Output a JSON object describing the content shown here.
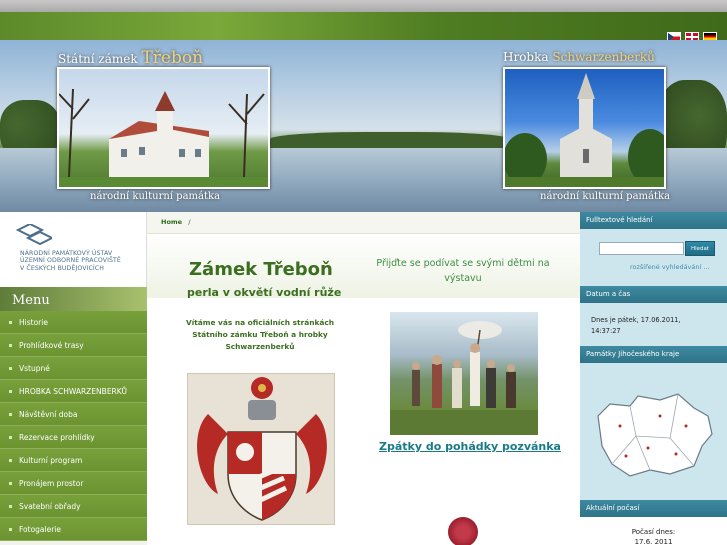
{
  "header": {
    "languages": [
      "cz-flag",
      "en-flag",
      "de-flag"
    ]
  },
  "banner": {
    "left_title_prefix": "Státní zámek",
    "left_title_name": "Třeboň",
    "right_title_prefix": "Hrobka",
    "right_title_name": "Schwarzenberků",
    "left_subtitle": "národní kulturní památka",
    "right_subtitle": "národní kulturní památka"
  },
  "institution": {
    "lines": [
      "NÁRODNÍ PAMÁTKOVÝ ÚSTAV",
      "ÚZEMNÍ ODBORNÉ PRACOVIŠTĚ",
      "V ČESKÝCH BUDĚJOVICÍCH"
    ]
  },
  "menu": {
    "title": "Menu",
    "items": [
      "Historie",
      "Prohlídkové trasy",
      "Vstupné",
      "HROBKA SCHWARZENBERKŮ",
      "Návštěvní doba",
      "Rezervace prohlídky",
      "Kulturní program",
      "Pronájem prostor",
      "Svatební obřady",
      "Fotogalerie"
    ]
  },
  "breadcrumb": {
    "home": "Home",
    "separator": "/"
  },
  "main": {
    "title": "Zámek Třeboň",
    "subtitle": "perla v okvětí vodní růže",
    "welcome": "Vítáme vás na oficiálních stránkách Státního zámku Třeboň a hrobky Schwarzenberků",
    "promo": "Přijďte se podívat se svými dětmi na výstavu",
    "promo_link": "Zpátky do pohádky pozvánka"
  },
  "sidebar": {
    "search_title": "Fulltextové hledání",
    "search_button": "Hledat",
    "search_value": "",
    "advanced_link": "rozšířené vyhledávání ...",
    "datetime_title": "Datum a čas",
    "datetime_line1": "Dnes je pátek, 17.06.2011,",
    "datetime_line2": "14:37:27",
    "region_title": "Památky Jihočeského kraje",
    "weather_title": "Aktuální počasí",
    "weather_line1": "Počasí dnes:",
    "weather_line2": "17.6. 2011"
  },
  "colors": {
    "menu_green": "#6b9431",
    "heading_green": "#3b6e1f",
    "sidebar_teal": "#2f7388",
    "link_teal": "#1a7a86"
  }
}
